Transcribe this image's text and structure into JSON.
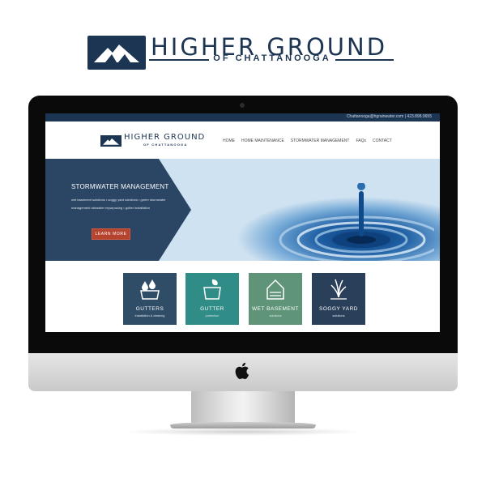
{
  "brand": {
    "title": "HIGHER GROUND",
    "subtitle": "OF CHATTANOOGA",
    "logo_icon": "mountain-icon",
    "color": "#1c3553"
  },
  "website": {
    "topbar_contact": "Chattanooga@hgrainwater.com  |  423.898.9655",
    "logo_title": "HIGHER GROUND",
    "logo_subtitle": "OF CHATTANOOGA",
    "nav": [
      "HOME",
      "HOME MAINTENANCE",
      "STORMWATER MANAGEMENT",
      "FAQs",
      "CONTACT"
    ],
    "hero": {
      "title": "STORMWATER MANAGEMENT",
      "description": "wet basement solutions • soggy yard solutions • green stormwater management rainwater repurposing • gutter installation",
      "button": "LEARN MORE",
      "button_color": "#b5432e"
    },
    "tiles": [
      {
        "title": "GUTTERS",
        "subtitle": "installation & cleaning",
        "icon": "water-drops-icon",
        "color": "#2f4d66"
      },
      {
        "title": "GUTTER",
        "subtitle": "protection",
        "icon": "leaf-gutter-icon",
        "color": "#2f8c86"
      },
      {
        "title": "WET BASEMENT",
        "subtitle": "solutions",
        "icon": "house-icon",
        "color": "#5f9479"
      },
      {
        "title": "SOGGY YARD",
        "subtitle": "solutions",
        "icon": "grass-icon",
        "color": "#2a3f5a"
      }
    ]
  },
  "device": {
    "icon": "apple-logo-icon"
  }
}
